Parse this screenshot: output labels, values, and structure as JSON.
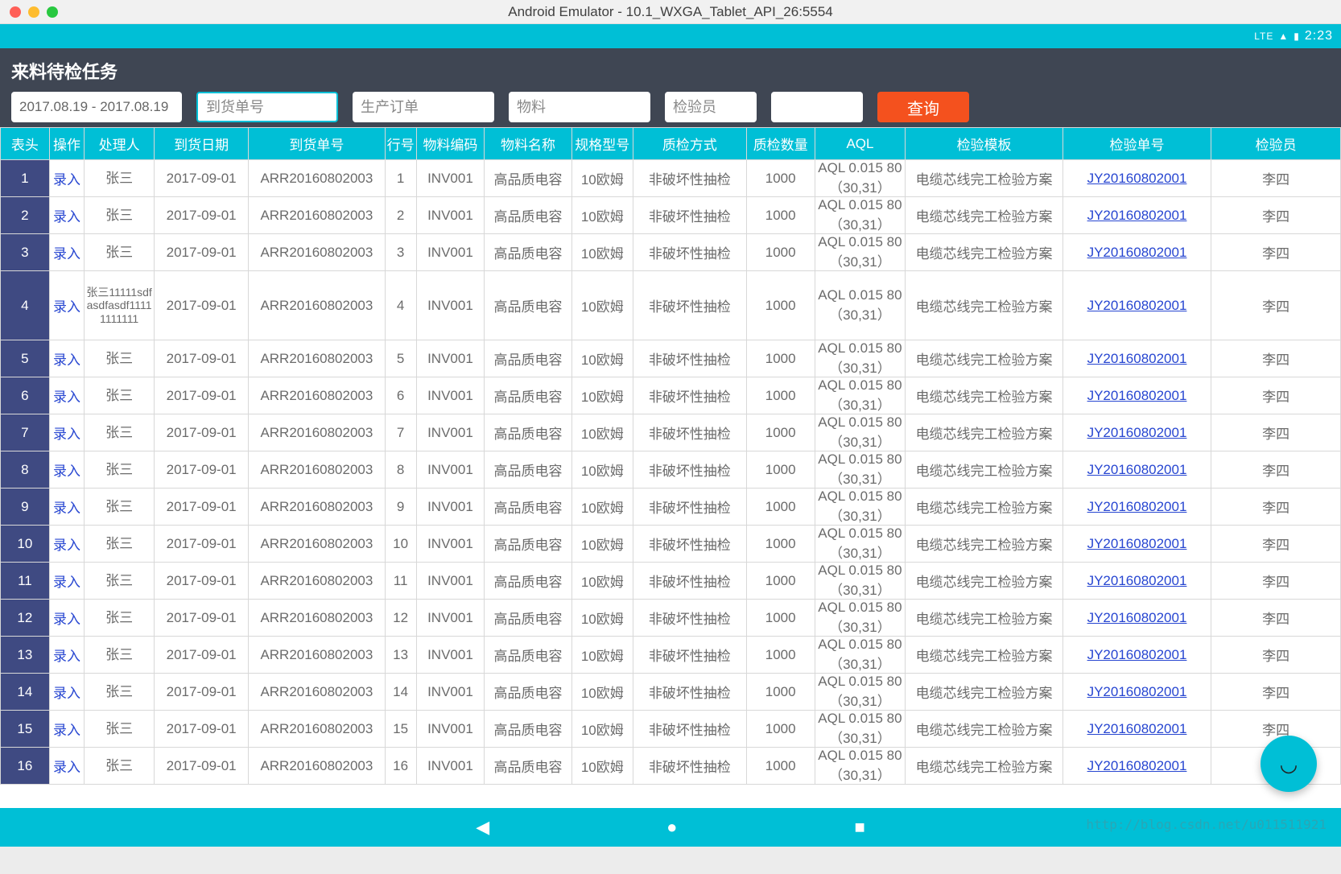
{
  "window": {
    "title": "Android Emulator - 10.1_WXGA_Tablet_API_26:5554"
  },
  "status": {
    "lte": "LTE",
    "time": "2:23"
  },
  "filter": {
    "title": "来料待检任务",
    "date_value": "2017.08.19 - 2017.08.19",
    "ph_arrival": "到货单号",
    "ph_order": "生产订单",
    "ph_material": "物料",
    "ph_inspector": "检验员",
    "btn_query": "查询"
  },
  "columns": {
    "idx": "表头",
    "op": "操作",
    "handler": "处理人",
    "date": "到货日期",
    "arrno": "到货单号",
    "lineno": "行号",
    "mcode": "物料编码",
    "mname": "物料名称",
    "spec": "规格型号",
    "qc": "质检方式",
    "qty": "质检数量",
    "aql": "AQL",
    "tpl": "检验模板",
    "ino": "检验单号",
    "ins": "检验员"
  },
  "row_defaults": {
    "op": "录入",
    "handler": "张三",
    "date": "2017-09-01",
    "arrno": "ARR20160802003",
    "mcode": "INV001",
    "mname": "高品质电容",
    "spec": "10欧姆",
    "qc": "非破坏性抽检",
    "qty": "1000",
    "aql": "AQL 0.015 80（30,31）",
    "tpl": "电缆芯线完工检验方案",
    "ino": "JY20160802001",
    "ins": "李四"
  },
  "rows": [
    {
      "idx": 1
    },
    {
      "idx": 2
    },
    {
      "idx": 3
    },
    {
      "idx": 4,
      "handler": "张三11111sdfasdfasdf11111111111"
    },
    {
      "idx": 5
    },
    {
      "idx": 6
    },
    {
      "idx": 7
    },
    {
      "idx": 8
    },
    {
      "idx": 9
    },
    {
      "idx": 10
    },
    {
      "idx": 11
    },
    {
      "idx": 12
    },
    {
      "idx": 13
    },
    {
      "idx": 14
    },
    {
      "idx": 15
    },
    {
      "idx": 16
    }
  ],
  "watermark": "http://blog.csdn.net/u011511921"
}
